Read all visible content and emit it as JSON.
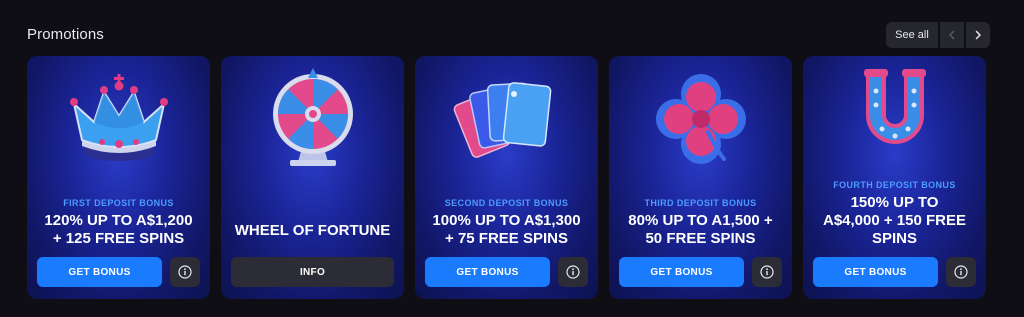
{
  "header": {
    "title": "Promotions",
    "see_all_label": "See all",
    "prev_icon": "chevron-left-icon",
    "next_icon": "chevron-right-icon"
  },
  "colors": {
    "background": "#0e0e14",
    "card_blue": "#1a2496",
    "accent_blue": "#1a7bff",
    "subtitle_blue": "#4d9bff",
    "secondary_button": "#2c2c36"
  },
  "cards": [
    {
      "art": "crown-icon",
      "subtitle": "FIRST DEPOSIT BONUS",
      "offer_line1": "120% UP TO A$1,200",
      "offer_line2": "+ 125 FREE SPINS",
      "button_label": "GET BONUS",
      "info_icon": "info-icon"
    },
    {
      "art": "wheel-of-fortune-icon",
      "subtitle": "",
      "offer_line1": "WHEEL OF FORTUNE",
      "offer_line2": "",
      "button_label": "INFO",
      "info_icon": ""
    },
    {
      "art": "playing-cards-icon",
      "subtitle": "SECOND DEPOSIT BONUS",
      "offer_line1": "100% UP TO A$1,300",
      "offer_line2": "+ 75 FREE SPINS",
      "button_label": "GET BONUS",
      "info_icon": "info-icon"
    },
    {
      "art": "clover-icon",
      "subtitle": "THIRD DEPOSIT BONUS",
      "offer_line1": "80% UP TO A1,500 +",
      "offer_line2": "50 FREE SPINS",
      "button_label": "GET BONUS",
      "info_icon": "info-icon"
    },
    {
      "art": "horseshoe-icon",
      "subtitle": "FOURTH DEPOSIT BONUS",
      "offer_line1": "150% UP TO",
      "offer_line2": "A$4,000 + 150 FREE",
      "offer_line3": "SPINS",
      "button_label": "GET BONUS",
      "info_icon": "info-icon"
    }
  ]
}
